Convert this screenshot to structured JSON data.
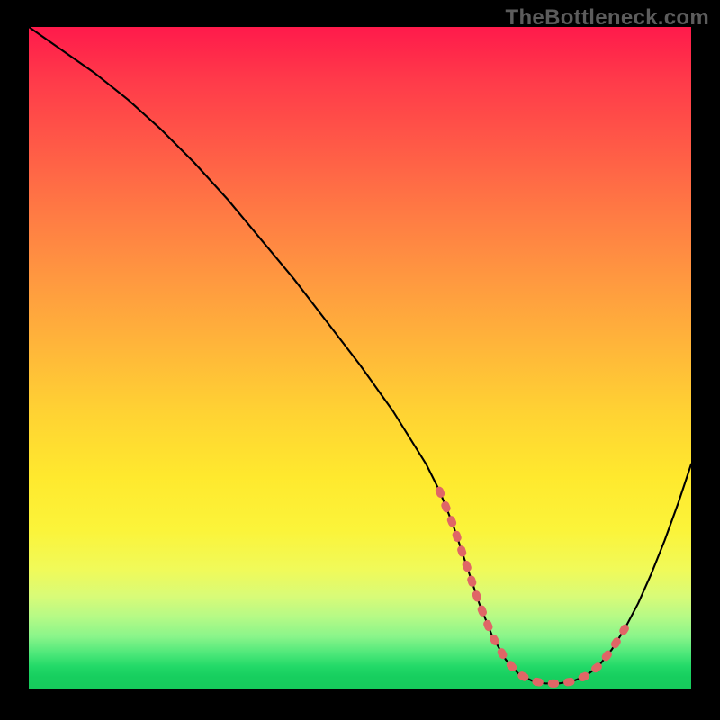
{
  "watermark": "TheBottleneck.com",
  "chart_data": {
    "type": "line",
    "title": "",
    "xlabel": "",
    "ylabel": "",
    "xlim": [
      0,
      100
    ],
    "ylim": [
      0,
      100
    ],
    "gradient_zones": [
      {
        "value": 100,
        "color": "#ff1a4b"
      },
      {
        "value": 0,
        "color": "#16ca5b"
      }
    ],
    "series": [
      {
        "name": "bottleneck-curve",
        "color": "#000000",
        "x": [
          0,
          5,
          10,
          15,
          20,
          25,
          30,
          35,
          40,
          45,
          50,
          55,
          60,
          62,
          64,
          66,
          68,
          70,
          72,
          74,
          76,
          78,
          80,
          82,
          84,
          86,
          88,
          90,
          92,
          94,
          96,
          98,
          100
        ],
        "values": [
          100,
          96.5,
          93,
          89,
          84.5,
          79.5,
          74,
          68,
          62,
          55.5,
          49,
          42,
          34,
          30,
          25,
          19,
          13,
          8,
          4.5,
          2.3,
          1.3,
          0.9,
          0.9,
          1.2,
          2.0,
          3.5,
          6.0,
          9.2,
          13,
          17.5,
          22.5,
          28,
          34
        ]
      },
      {
        "name": "highlight-range",
        "color": "#e06666",
        "x": [
          62,
          64,
          66,
          68,
          70,
          72,
          74,
          76,
          78,
          80,
          82,
          84,
          86,
          88,
          90
        ],
        "values": [
          30,
          25,
          19,
          13,
          8,
          4.5,
          2.3,
          1.3,
          0.9,
          0.9,
          1.2,
          2.0,
          3.5,
          6.0,
          9.2
        ]
      }
    ]
  }
}
